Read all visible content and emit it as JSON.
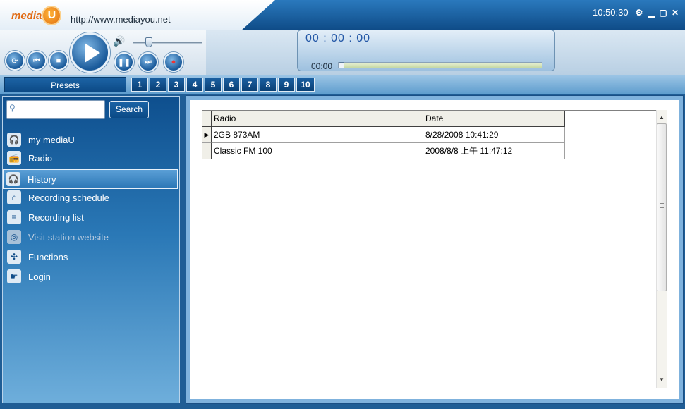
{
  "app": {
    "logo_text": "media",
    "logo_u": "U",
    "site_url": "http://www.mediayou.net",
    "clock": "10:50:30"
  },
  "window_controls": {
    "icon_names": [
      "settings-icon",
      "minimize-icon",
      "maximize-icon",
      "close-icon"
    ]
  },
  "player": {
    "display_time": "00 : 00 : 00",
    "elapsed": "00:00",
    "progress": 0,
    "volume": 0.2,
    "buttons": [
      "refresh-icon",
      "previous-icon",
      "stop-icon",
      "play-icon",
      "volume-icon",
      "pause-icon",
      "next-icon",
      "record-icon"
    ]
  },
  "presets": {
    "tab_label": "Presets",
    "numbers": [
      "1",
      "2",
      "3",
      "4",
      "5",
      "6",
      "7",
      "8",
      "9",
      "10"
    ]
  },
  "search": {
    "placeholder": "",
    "button_label": "Search"
  },
  "sidebar": {
    "items": [
      {
        "label": "my mediaU",
        "icon": "headphones-u-icon",
        "active": false,
        "disabled": false
      },
      {
        "label": "Radio",
        "icon": "radio-waves-icon",
        "active": false,
        "disabled": false
      },
      {
        "label": "History",
        "icon": "headphones-icon",
        "active": true,
        "disabled": false
      },
      {
        "label": "Recording schedule",
        "icon": "tape-icon",
        "active": false,
        "disabled": false
      },
      {
        "label": "Recording list",
        "icon": "list-icon",
        "active": false,
        "disabled": false
      },
      {
        "label": "Visit station website",
        "icon": "globe-icon",
        "active": false,
        "disabled": true
      },
      {
        "label": "Functions",
        "icon": "functions-icon",
        "active": false,
        "disabled": false
      },
      {
        "label": "Login",
        "icon": "login-hand-icon",
        "active": false,
        "disabled": false
      }
    ]
  },
  "history_table": {
    "columns": [
      "Radio",
      "Date"
    ],
    "rows": [
      {
        "radio": "2GB 873AM",
        "date": "8/28/2008 10:41:29",
        "current": true
      },
      {
        "radio": "Classic FM 100",
        "date": "2008/8/8 上午 11:47:12",
        "current": false
      }
    ]
  },
  "colors": {
    "accent": "#1a5a9a",
    "title_gradient": "#0f4c88"
  }
}
